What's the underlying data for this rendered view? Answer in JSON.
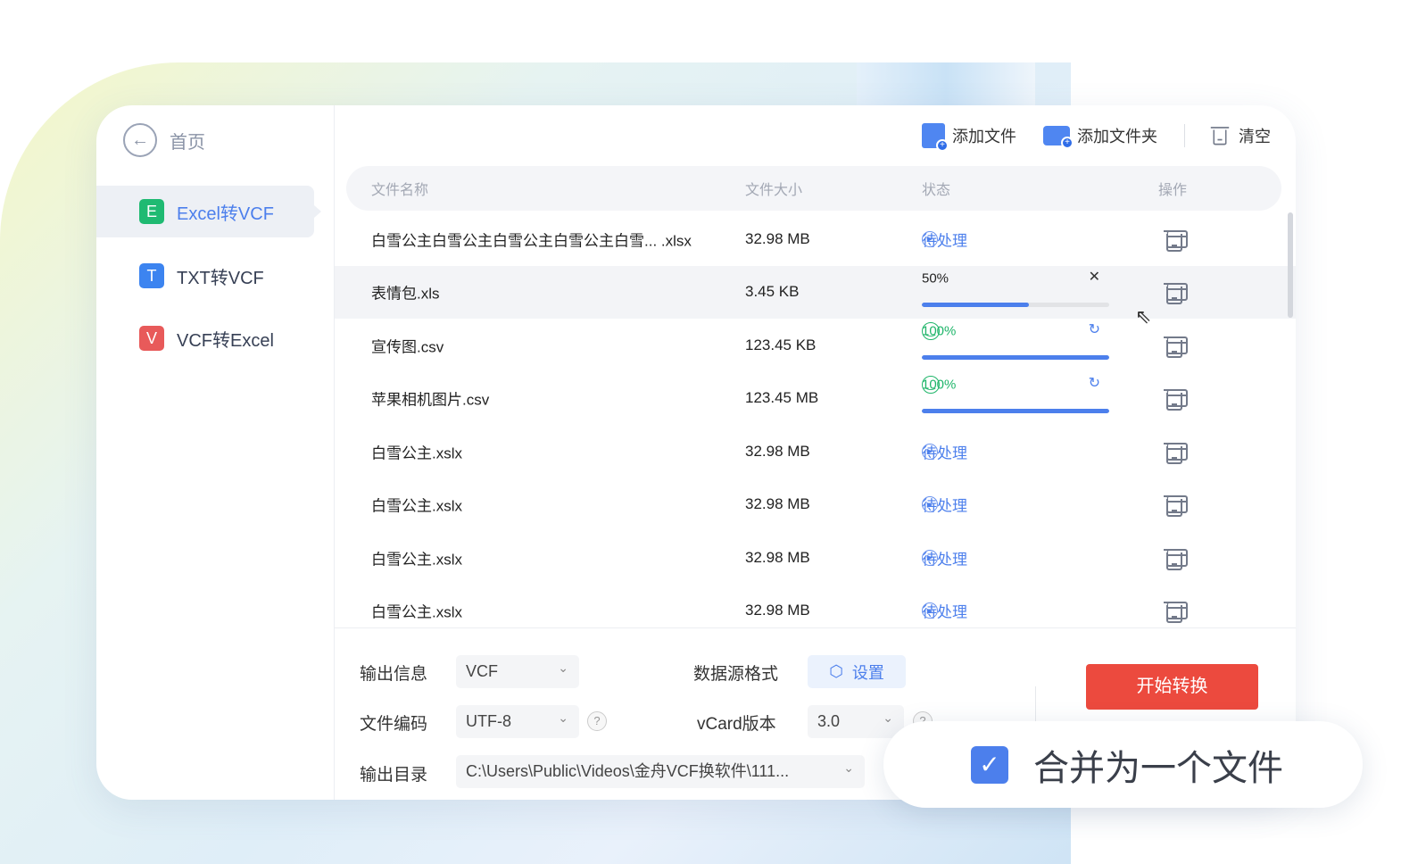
{
  "sidebar": {
    "home": "首页",
    "items": [
      {
        "icon": "E",
        "label": "Excel转VCF",
        "color": "#1fba72"
      },
      {
        "icon": "T",
        "label": "TXT转VCF",
        "color": "#3c84f0"
      },
      {
        "icon": "V",
        "label": "VCF转Excel",
        "color": "#e85a5a"
      }
    ]
  },
  "toolbar": {
    "add_file": "添加文件",
    "add_folder": "添加文件夹",
    "clear": "清空"
  },
  "table": {
    "headers": [
      "文件名称",
      "文件大小",
      "状态",
      "操作"
    ],
    "rows": [
      {
        "name": "白雪公主白雪公主白雪公主白雪公主白雪... .xlsx",
        "size": "32.98 MB",
        "status": "待处理"
      },
      {
        "name": "表情包.xls",
        "size": "3.45 KB",
        "progress": "50%"
      },
      {
        "name": "宣传图.csv",
        "size": "123.45 KB",
        "progress": "100%"
      },
      {
        "name": "苹果相机图片.csv",
        "size": "123.45 MB",
        "progress": "100%"
      },
      {
        "name": "白雪公主.xslx",
        "size": "32.98 MB",
        "status": "待处理"
      },
      {
        "name": "白雪公主.xslx",
        "size": "32.98 MB",
        "status": "待处理"
      },
      {
        "name": "白雪公主.xslx",
        "size": "32.98 MB",
        "status": "待处理"
      },
      {
        "name": "白雪公主.xslx",
        "size": "32.98 MB",
        "status": "待处理"
      }
    ]
  },
  "settings": {
    "output_info_label": "输出信息",
    "output_info": "VCF",
    "encoding_label": "文件编码",
    "encoding": "UTF-8",
    "dir_label": "输出目录",
    "dir": "C:\\Users\\Public\\Videos\\金舟VCF换软件\\111...",
    "source_label": "数据源格式",
    "source_btn": "设置",
    "vcard_label": "vCard版本",
    "vcard": "3.0",
    "help": "?"
  },
  "start": "开始转换",
  "merge": "合并为一个文件"
}
